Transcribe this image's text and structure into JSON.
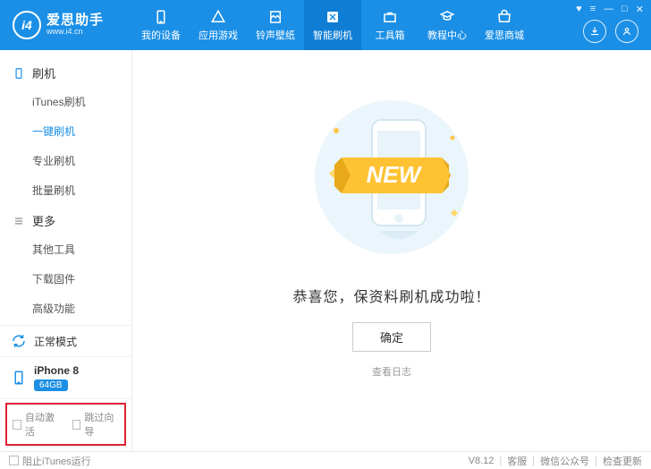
{
  "app": {
    "name": "爱思助手",
    "url": "www.i4.cn",
    "logo_glyph": "i4"
  },
  "nav": [
    {
      "label": "我的设备"
    },
    {
      "label": "应用游戏"
    },
    {
      "label": "铃声壁纸"
    },
    {
      "label": "智能刷机",
      "active": true
    },
    {
      "label": "工具箱"
    },
    {
      "label": "教程中心"
    },
    {
      "label": "爱思商城"
    }
  ],
  "sidebar": {
    "groups": [
      {
        "title": "刷机",
        "items": [
          {
            "label": "iTunes刷机"
          },
          {
            "label": "一键刷机",
            "active": true
          },
          {
            "label": "专业刷机"
          },
          {
            "label": "批量刷机"
          }
        ]
      },
      {
        "title": "更多",
        "items": [
          {
            "label": "其他工具"
          },
          {
            "label": "下载固件"
          },
          {
            "label": "高级功能"
          }
        ]
      }
    ],
    "mode": "正常模式",
    "device": {
      "name": "iPhone 8",
      "storage": "64GB"
    },
    "opts": {
      "auto_activate": "自动激活",
      "skip_guide": "跳过向导"
    }
  },
  "main": {
    "illus_text": "NEW",
    "message": "恭喜您，保资料刷机成功啦！",
    "confirm": "确定",
    "view_log": "查看日志"
  },
  "footer": {
    "block_itunes": "阻止iTunes运行",
    "version": "V8.12",
    "links": [
      "客服",
      "微信公众号",
      "检查更新"
    ]
  }
}
